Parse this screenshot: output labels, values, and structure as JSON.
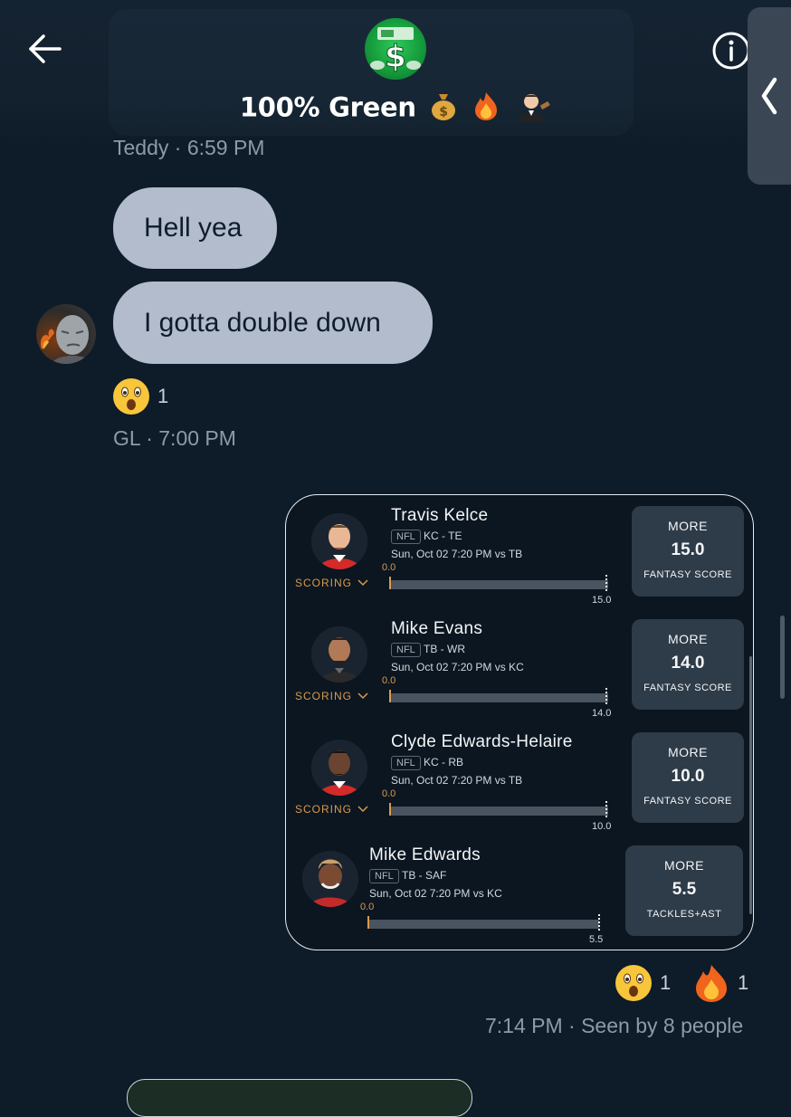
{
  "header": {
    "title": "100% Green",
    "title_emojis": [
      "money-bag",
      "fire",
      "man-judge"
    ]
  },
  "messages": [
    {
      "sender": "Teddy",
      "time": "· 6:59 PM",
      "texts": [
        "Hell yea",
        "I gotta double down"
      ],
      "reaction": {
        "emoji": "astonished-face",
        "count": "1"
      }
    },
    {
      "sender": "GL",
      "time": "· 7:00 PM"
    }
  ],
  "card": {
    "picks": [
      {
        "name": "Travis Kelce",
        "league": "NFL",
        "team_pos": "KC - TE",
        "game": "Sun, Oct 02 7:20 PM  vs TB",
        "progress_start": "0.0",
        "progress_end": "15.0",
        "scoring": "SCORING",
        "more": "MORE",
        "line": "15.0",
        "stat": "FANTASY SCORE"
      },
      {
        "name": "Mike Evans",
        "league": "NFL",
        "team_pos": "TB - WR",
        "game": "Sun, Oct 02 7:20 PM  vs KC",
        "progress_start": "0.0",
        "progress_end": "14.0",
        "scoring": "SCORING",
        "more": "MORE",
        "line": "14.0",
        "stat": "FANTASY SCORE"
      },
      {
        "name": "Clyde Edwards-Helaire",
        "league": "NFL",
        "team_pos": "KC - RB",
        "game": "Sun, Oct 02 7:20 PM  vs TB",
        "progress_start": "0.0",
        "progress_end": "10.0",
        "scoring": "SCORING",
        "more": "MORE",
        "line": "10.0",
        "stat": "FANTASY SCORE"
      },
      {
        "name": "Mike Edwards",
        "league": "NFL",
        "team_pos": "TB - SAF",
        "game": "Sun, Oct 02 7:20 PM  vs KC",
        "progress_start": "0.0",
        "progress_end": "5.5",
        "more": "MORE",
        "line": "5.5",
        "stat": "TACKLES+AST"
      }
    ]
  },
  "card_reactions": [
    {
      "emoji": "astonished-face",
      "count": "1"
    },
    {
      "emoji": "fire",
      "count": "1"
    }
  ],
  "footer": {
    "time": "7:14 PM",
    "seen": "· Seen by 8 people"
  },
  "colors": {
    "background": "#0e1b28",
    "bubble": "#b2bccc",
    "accent_orange": "#d99a4e",
    "more_box": "#2e3b48"
  }
}
